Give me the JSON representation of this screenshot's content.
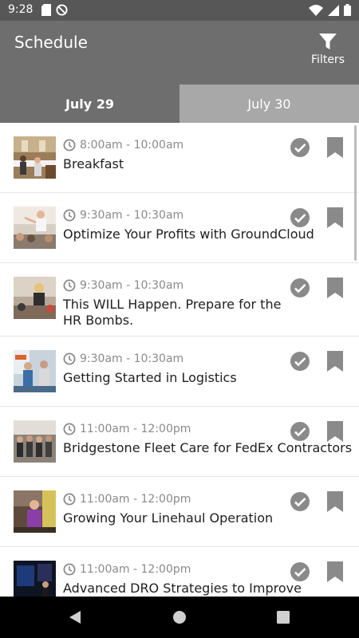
{
  "status_bar": {
    "time": "9:28",
    "left_icons": [
      "sd-card-icon",
      "no-sync-icon"
    ],
    "right_icons": [
      "wifi-icon",
      "signal-icon",
      "battery-icon"
    ]
  },
  "app_bar": {
    "title": "Schedule",
    "filters_label": "Filters"
  },
  "tabs": [
    {
      "label": "July 29",
      "active": true
    },
    {
      "label": "July 30",
      "active": false
    }
  ],
  "sessions": [
    {
      "time": "8:00am - 10:00am",
      "title": "Breakfast"
    },
    {
      "time": "9:30am - 10:30am",
      "title": "Optimize Your Profits with GroundCloud"
    },
    {
      "time": "9:30am - 10:30am",
      "title": "This WILL Happen. Prepare for the HR Bombs."
    },
    {
      "time": "9:30am - 10:30am",
      "title": "Getting Started in Logistics"
    },
    {
      "time": "11:00am - 12:00pm",
      "title": "Bridgestone Fleet Care for FedEx Contractors"
    },
    {
      "time": "11:00am - 12:00pm",
      "title": "Growing Your Linehaul Operation"
    },
    {
      "time": "11:00am - 12:00pm",
      "title": "Advanced DRO Strategies to Improve"
    }
  ],
  "colors": {
    "app_bar": "#6e6e6e",
    "status_bar": "#575757",
    "tab_inactive": "#a8a8a8",
    "icon_gray": "#8a8a8a"
  }
}
